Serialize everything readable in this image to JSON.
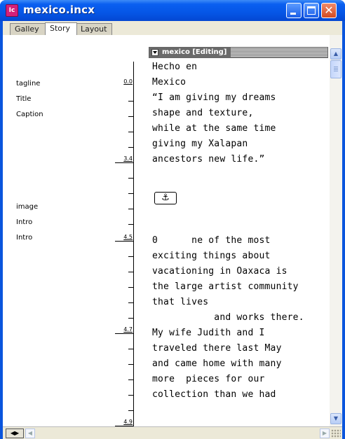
{
  "window": {
    "title": "mexico.incx",
    "app_icon_label": "Ic",
    "icon": "incopy-app-icon",
    "close_glyph": "✕"
  },
  "tabs": [
    {
      "label": "Galley",
      "active": false
    },
    {
      "label": "Story",
      "active": true
    },
    {
      "label": "Layout",
      "active": false
    }
  ],
  "info_column": {
    "depths": [
      "0.0",
      "3.4",
      "4.5",
      "4.7",
      "4.9"
    ],
    "style_labels": [
      "tagline",
      "Title",
      "Caption",
      "image",
      "Intro",
      "Intro"
    ]
  },
  "story": {
    "header_label": "mexico [Editing]",
    "lines": [
      "Hecho en",
      "Mexico",
      "“I am giving my dreams",
      "shape and texture,",
      "while at the same time",
      "giving my Xalapan",
      "ancestors new life.”",
      "",
      "",
      "0      ne of the most",
      "exciting things about",
      "vacationing in Oaxaca is",
      "the large artist community",
      "that lives",
      "           and works there.",
      "My wife Judith and I",
      "traveled there last May",
      "and came home with many",
      "more  pieces for our",
      "collection than we had"
    ],
    "anchor_glyph": "⚓"
  },
  "scrollbar": {
    "up_glyph": "▲",
    "down_glyph": "▼"
  },
  "bottom": {
    "split_glyph": "◀▶",
    "left_glyph": "◀",
    "right_glyph": "▶"
  }
}
